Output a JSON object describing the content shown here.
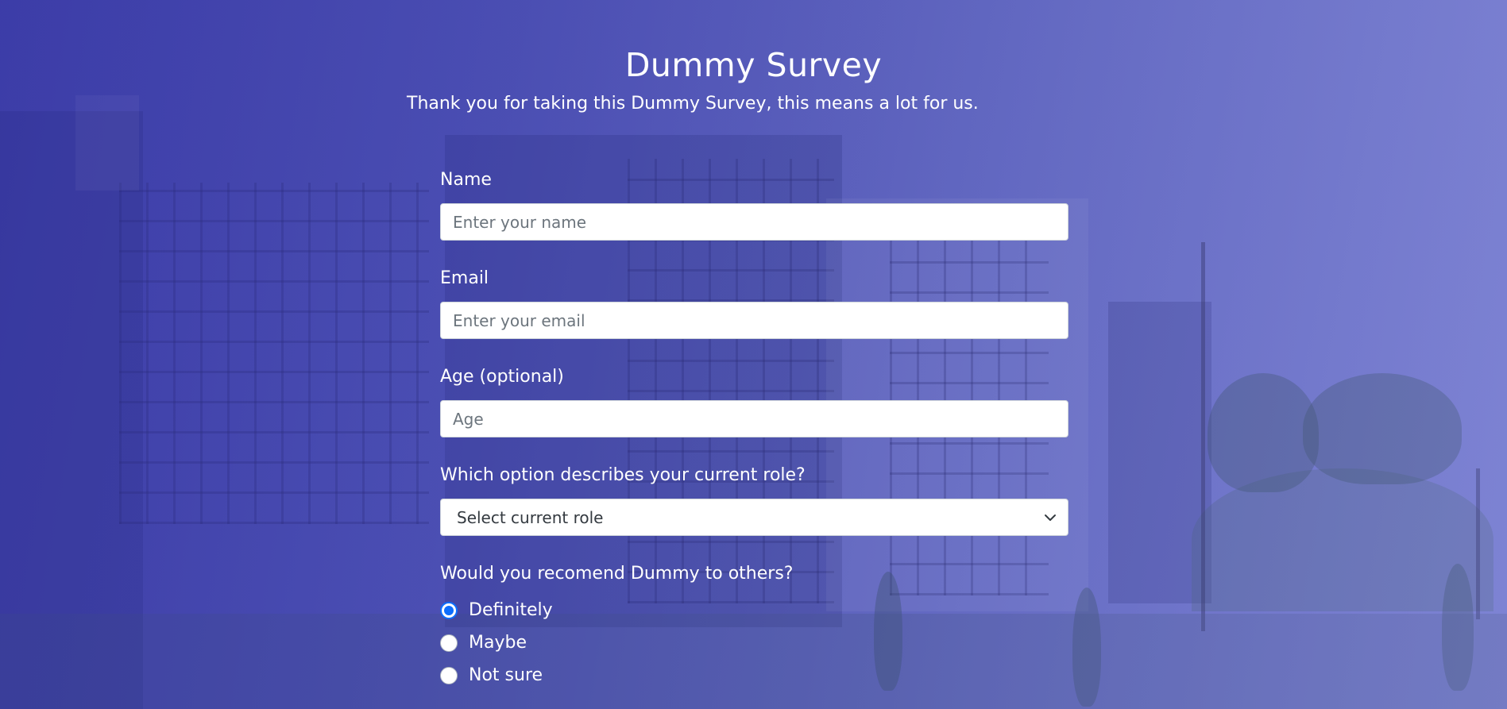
{
  "page": {
    "title": "Dummy Survey",
    "subtitle": "Thank you for taking this Dummy Survey, this means a lot for us."
  },
  "form": {
    "name": {
      "label": "Name",
      "placeholder": "Enter your name"
    },
    "email": {
      "label": "Email",
      "placeholder": "Enter your email"
    },
    "age": {
      "label": "Age (optional)",
      "placeholder": "Age"
    },
    "role": {
      "label": "Which option describes your current role?",
      "selected": "Select current role"
    },
    "recommend": {
      "label": "Would you recomend Dummy to others?",
      "options": [
        {
          "label": "Definitely",
          "checked": true
        },
        {
          "label": "Maybe",
          "checked": false
        },
        {
          "label": "Not sure",
          "checked": false
        }
      ]
    }
  },
  "colors": {
    "accent": "#0d6efd",
    "background": "#4b4fb2",
    "text": "#ffffff"
  },
  "icons": {
    "select_caret": "chevron-down-icon"
  }
}
